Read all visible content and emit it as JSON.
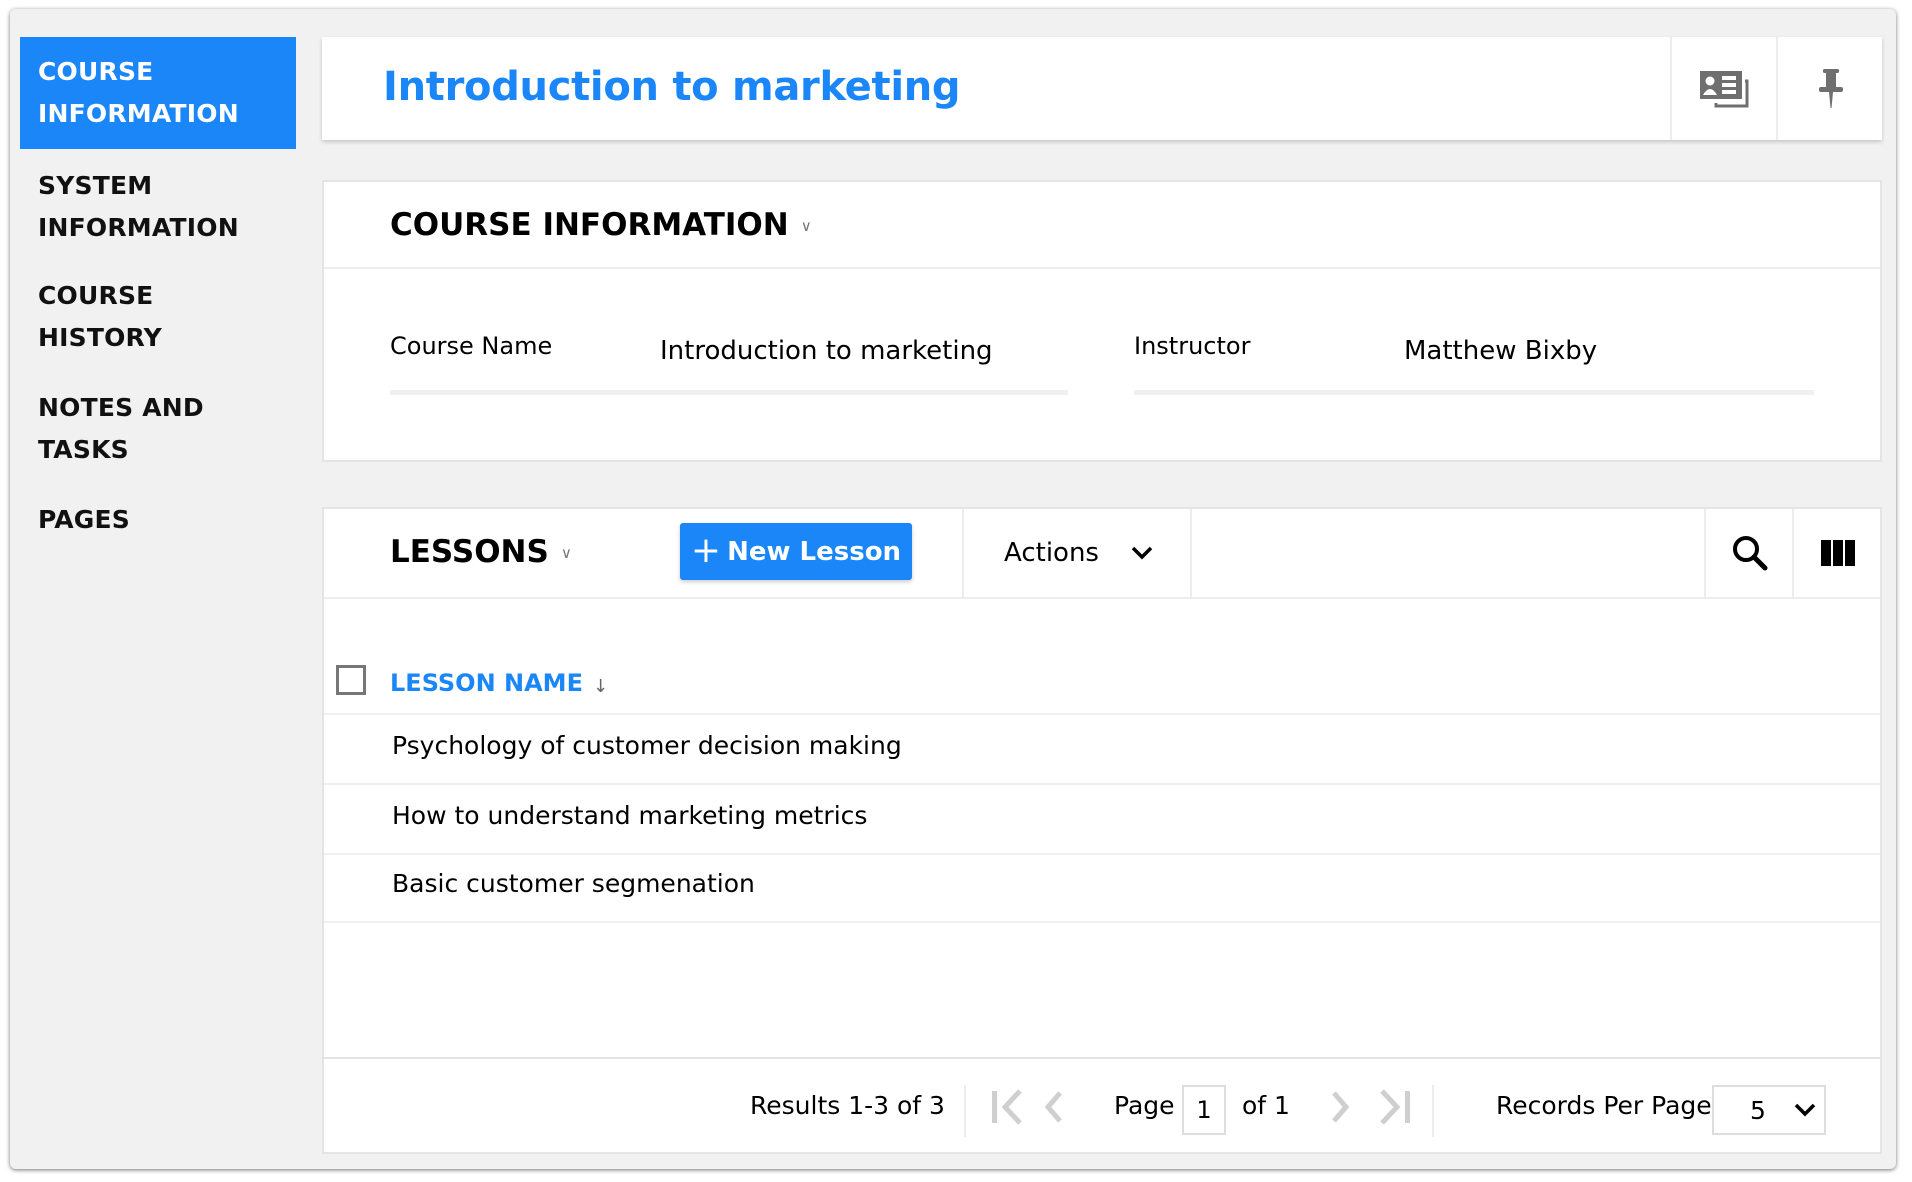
{
  "sidebar": {
    "items": [
      {
        "label": "COURSE INFORMATION",
        "active": true
      },
      {
        "label": "SYSTEM INFORMATION",
        "active": false
      },
      {
        "label": "COURSE HISTORY",
        "active": false
      },
      {
        "label": "NOTES AND TASKS",
        "active": false
      },
      {
        "label": "PAGES",
        "active": false
      }
    ]
  },
  "header": {
    "title": "Introduction to marketing",
    "icons": [
      "contact-card-icon",
      "pin-icon"
    ]
  },
  "course_info": {
    "section_title": "COURSE INFORMATION",
    "fields": [
      {
        "label": "Course Name",
        "value": "Introduction to marketing"
      },
      {
        "label": "Instructor",
        "value": "Matthew Bixby"
      }
    ]
  },
  "lessons": {
    "section_title": "LESSONS",
    "new_button_label": "New Lesson",
    "actions_label": "Actions",
    "column_header": "LESSON NAME",
    "sort_indicator": "↓",
    "rows": [
      "Psychology of customer decision making",
      "How to understand marketing metrics",
      "Basic customer segmenation"
    ],
    "pagination": {
      "results_text": "Results 1-3 of 3",
      "page_label": "Page",
      "current_page": "1",
      "of_text": "of 1",
      "records_per_page_label": "Records Per Page",
      "records_per_page_value": "5"
    }
  },
  "colors": {
    "accent": "#1a86f8",
    "background": "#f1f1f1",
    "icon_gray": "#6f6f6f",
    "disabled_gray": "#cfcfcf"
  }
}
